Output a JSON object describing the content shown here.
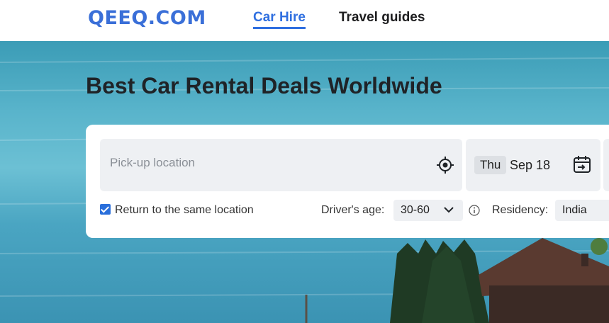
{
  "header": {
    "logo": "QEEQ.COM",
    "nav": [
      {
        "label": "Car Hire",
        "active": true
      },
      {
        "label": "Travel guides",
        "active": false
      }
    ]
  },
  "hero": {
    "title": "Best Car Rental Deals Worldwide"
  },
  "search": {
    "pickup_placeholder": "Pick-up location",
    "pickup_day": "Thu",
    "pickup_date": "Sep 18",
    "return_same_label": "Return to the same location",
    "return_same_checked": true,
    "driver_age_label": "Driver's age:",
    "driver_age_value": "30-60",
    "residency_label": "Residency:",
    "residency_value": "India"
  },
  "icons": {
    "location": "crosshair-icon",
    "calendar": "calendar-icon",
    "age_dropdown": "chevron-down-icon",
    "info": "info-icon"
  },
  "colors": {
    "brand": "#2f6fe0",
    "checkbox": "#2a6fdb"
  }
}
